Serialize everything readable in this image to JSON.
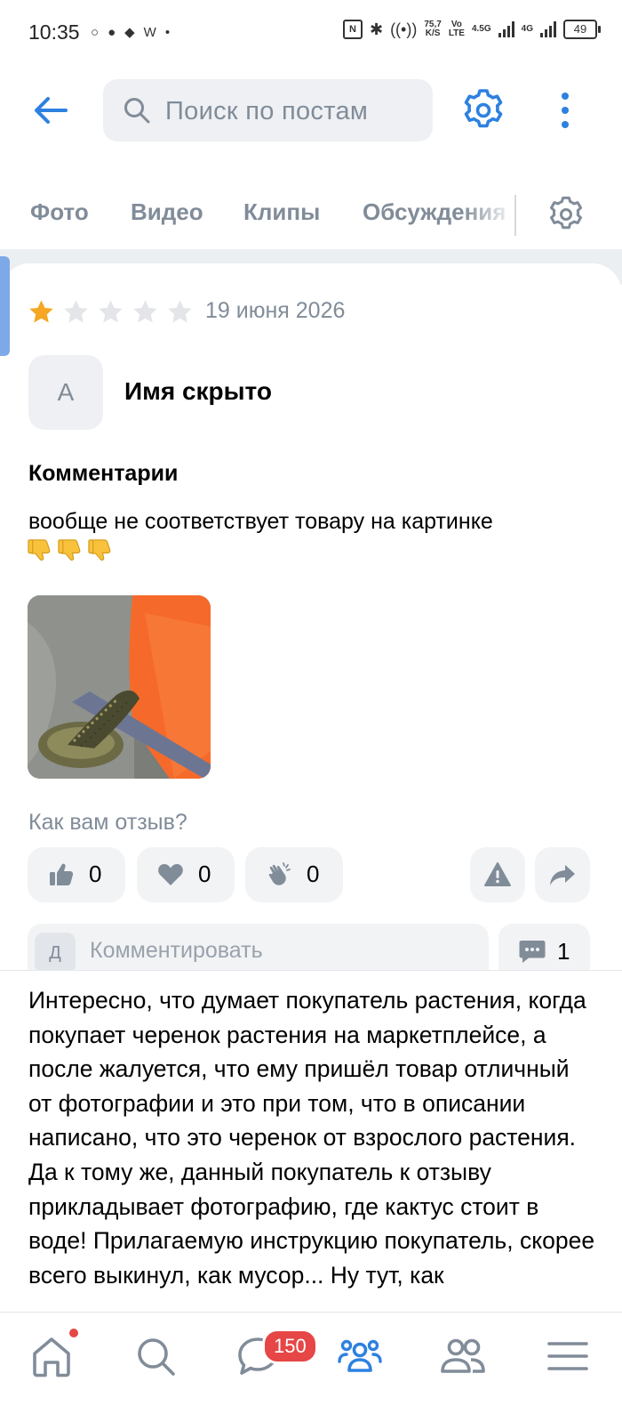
{
  "status_bar": {
    "time": "10:35",
    "net_speed_value": "75,7",
    "net_speed_unit": "K/S",
    "volte_top": "Vo",
    "volte_bottom": "LTE",
    "net1": "4.5G",
    "net2": "4G",
    "battery": "49",
    "w_label": "W"
  },
  "toolbar": {
    "search_placeholder": "Поиск по постам"
  },
  "tabs": [
    "Фото",
    "Видео",
    "Клипы",
    "Обсуждения"
  ],
  "review": {
    "rating": 1,
    "max_rating": 5,
    "date": "19 июня 2026",
    "avatar_letter": "А",
    "author": "Имя скрыто",
    "comments_heading": "Комментарии",
    "text": "вообще не соответствует товару на картинке"
  },
  "feedback": {
    "question": "Как вам отзыв?",
    "likes": "0",
    "hearts": "0",
    "claps": "0"
  },
  "comment_input": {
    "avatar_letter": "Д",
    "placeholder": "Комментировать",
    "count": "1"
  },
  "overlay_comment": {
    "text": "Интересно, что думает покупатель растения, когда покупает черенок растения на маркетплейсе, а после жалуется, что ему пришёл товар отличный от фотографии и это при том, что в описании написано, что это черенок от взрослого растения. Да к тому же, данный покупатель к отзыву прикладывает фотографию, где кактус стоит в воде! Прилагаемую инструкцию покупатель, скорее всего выкинул, как мусор... Ну тут, как"
  },
  "bottom_nav": {
    "messages_badge": "150"
  },
  "colors": {
    "accent": "#2d81e0",
    "muted": "#818c99",
    "star_active": "#f5a623",
    "star_inactive": "#e3e5e8",
    "badge": "#e64646"
  }
}
